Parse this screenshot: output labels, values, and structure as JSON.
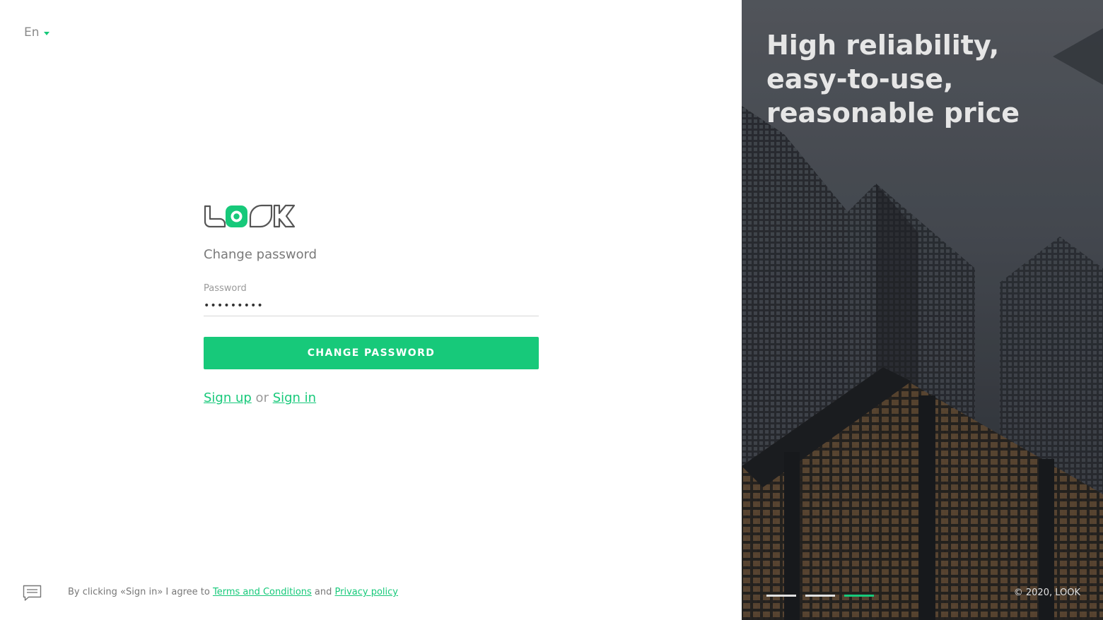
{
  "language": {
    "current": "En"
  },
  "form": {
    "title": "Change password",
    "password_label": "Password",
    "password_value": "•••••••••",
    "submit_label": "CHANGE PASSWORD",
    "signup_label": "Sign up",
    "or_text": " or ",
    "signin_label": "Sign in"
  },
  "footer": {
    "legal_prefix": "By clicking «Sign in» I agree to ",
    "terms_label": "Terms and Conditions",
    "and_text": " and ",
    "privacy_label": "Privacy policy",
    "chat_icon": "chat-bubble-icon"
  },
  "promo": {
    "tagline": "High reliability, easy-to-use, reasonable price",
    "slides": [
      {
        "active": false
      },
      {
        "active": false
      },
      {
        "active": true
      }
    ],
    "copyright": "© 2020, LOOK"
  },
  "colors": {
    "accent": "#17c97a",
    "panel_dark": "#3d4148",
    "text_muted": "#7a7a7a"
  }
}
